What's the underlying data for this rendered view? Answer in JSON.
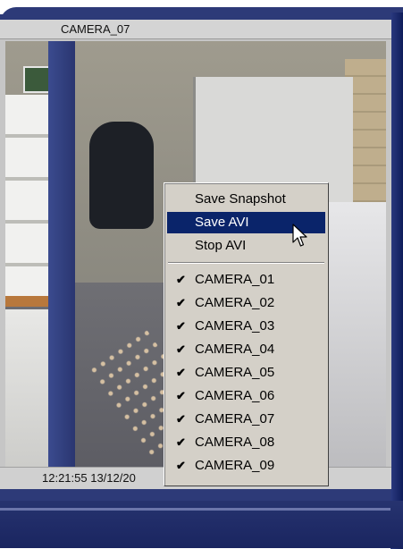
{
  "window": {
    "camera_title": "CAMERA_07",
    "timestamp": "12:21:55 13/12/20"
  },
  "context_menu": {
    "actions": [
      {
        "label": "Save Snapshot",
        "highlighted": false
      },
      {
        "label": "Save AVI",
        "highlighted": true
      },
      {
        "label": "Stop AVI",
        "highlighted": false
      }
    ],
    "cameras": [
      {
        "label": "CAMERA_01",
        "checked": true
      },
      {
        "label": "CAMERA_02",
        "checked": true
      },
      {
        "label": "CAMERA_03",
        "checked": true
      },
      {
        "label": "CAMERA_04",
        "checked": true
      },
      {
        "label": "CAMERA_05",
        "checked": true
      },
      {
        "label": "CAMERA_06",
        "checked": true
      },
      {
        "label": "CAMERA_07",
        "checked": true
      },
      {
        "label": "CAMERA_08",
        "checked": true
      },
      {
        "label": "CAMERA_09",
        "checked": true
      }
    ],
    "check_glyph": "✔"
  },
  "icons": {
    "cursor": "mouse-pointer-icon",
    "check": "checkmark-icon"
  },
  "colors": {
    "frame_navy": "#2d3a78",
    "menu_background": "#d4d0c8",
    "menu_highlight": "#0a246a",
    "panel_gray": "#c6c6c6"
  }
}
